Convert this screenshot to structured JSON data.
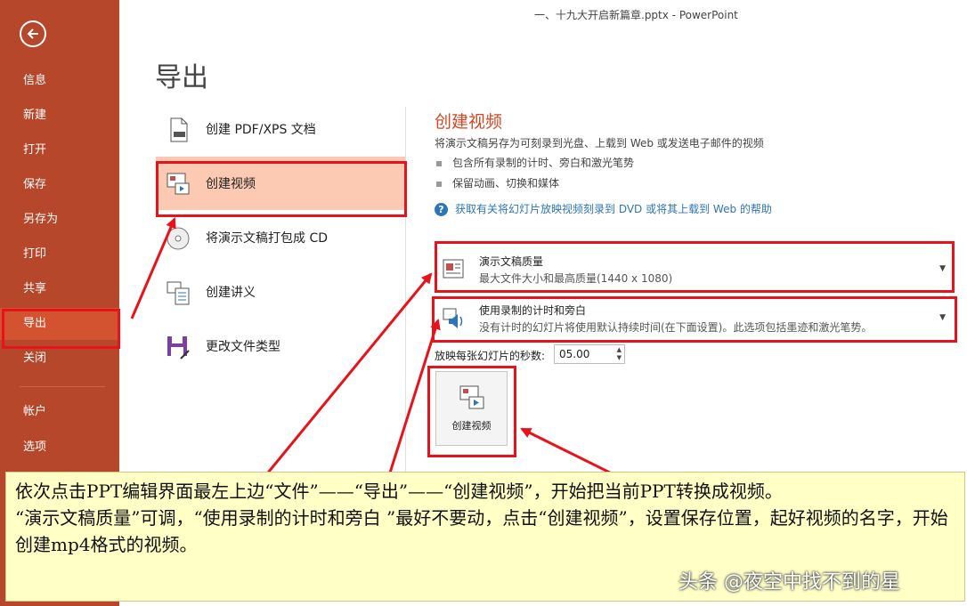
{
  "window": {
    "title": "一、十九大开启新篇章.pptx - PowerPoint"
  },
  "sidebar": {
    "back_icon": "back-arrow-icon",
    "items": [
      {
        "label": "信息"
      },
      {
        "label": "新建"
      },
      {
        "label": "打开"
      },
      {
        "label": "保存"
      },
      {
        "label": "另存为"
      },
      {
        "label": "打印"
      },
      {
        "label": "共享"
      },
      {
        "label": "导出",
        "active": true
      },
      {
        "label": "关闭"
      },
      {
        "label": "帐户"
      },
      {
        "label": "选项"
      }
    ],
    "color": "#b7472a",
    "active_color": "#d35230"
  },
  "main": {
    "title": "导出",
    "options": [
      {
        "label": "创建 PDF/XPS 文档",
        "icon": "pdf-document-icon"
      },
      {
        "label": "创建视频",
        "icon": "video-icon",
        "selected": true
      },
      {
        "label": "将演示文稿打包成 CD",
        "icon": "cd-icon"
      },
      {
        "label": "创建讲义",
        "icon": "handout-icon"
      },
      {
        "label": "更改文件类型",
        "icon": "file-type-icon"
      }
    ]
  },
  "detail": {
    "title": "创建视频",
    "description": "将演示文稿另存为可刻录到光盘、上载到 Web 或发送电子邮件的视频",
    "bullets": [
      "包含所有录制的计时、旁白和激光笔势",
      "保留动画、切换和媒体"
    ],
    "help_link": "获取有关将幻灯片放映视频刻录到 DVD 或将其上载到 Web 的帮助",
    "quality": {
      "title": "演示文稿质量",
      "subtitle": "最大文件大小和最高质量(1440 x 1080)"
    },
    "timing": {
      "title": "使用录制的计时和旁白",
      "subtitle": "没有计时的幻灯片将使用默认持续时间(在下面设置)。此选项包括墨迹和激光笔势。"
    },
    "seconds_label": "放映每张幻灯片的秒数:",
    "seconds_value": "05.00",
    "create_button": "创建视频",
    "accent_color": "#d24726"
  },
  "note": {
    "line1": "依次点击PPT编辑界面最左上边“文件”——“导出”——“创建视频”，开始把当前PPT转换成视频。",
    "line2": "“演示文稿质量”可调，“使用录制的计时和旁白 ”最好不要动，点击“创建视频”，设置保存位置，起好视频的名字，开始创建mp4格式的视频。"
  },
  "watermark": "头条 @夜空中找不到的星",
  "annotation_color": "#e8121a"
}
